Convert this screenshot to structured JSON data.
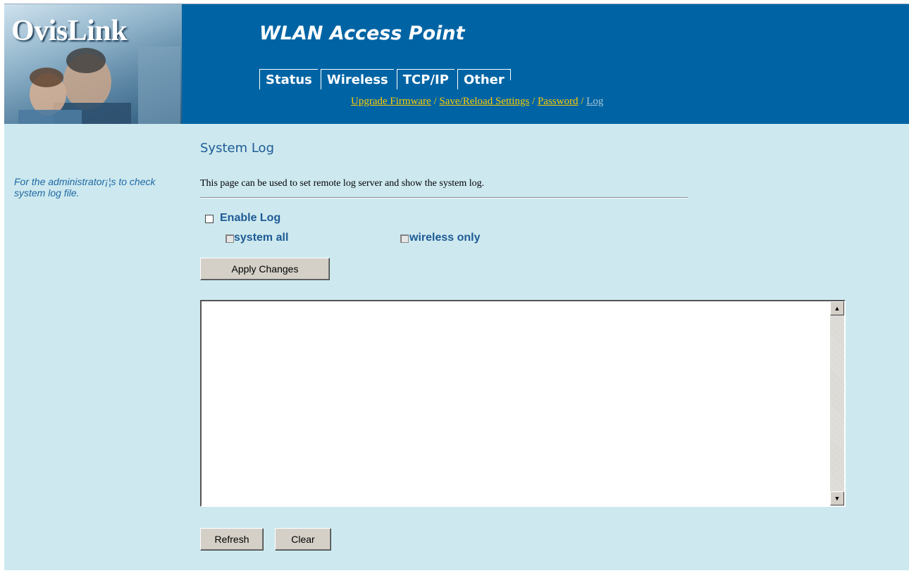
{
  "header": {
    "logo_text": "OvisLink",
    "app_title": "WLAN Access Point",
    "tabs": [
      {
        "label": "Status"
      },
      {
        "label": "Wireless"
      },
      {
        "label": "TCP/IP"
      },
      {
        "label": "Other"
      }
    ],
    "subnav": {
      "items": [
        {
          "label": "Upgrade Firmware"
        },
        {
          "label": "Save/Reload Settings"
        },
        {
          "label": "Password"
        },
        {
          "label": "Log"
        }
      ],
      "separator": "/"
    }
  },
  "sidebar": {
    "note": "For the administrator¡¦s to check system log file."
  },
  "main": {
    "title": "System Log",
    "description": "This page can be used to set remote log server and show the system log.",
    "enable_log": {
      "label": "Enable Log",
      "checked": false
    },
    "system_all": {
      "label": "system all",
      "checked": false,
      "disabled": true
    },
    "wireless_only": {
      "label": "wireless only",
      "checked": false,
      "disabled": true
    },
    "apply_label": "Apply Changes",
    "log_text": "",
    "refresh_label": "Refresh",
    "clear_label": "Clear"
  },
  "colors": {
    "header_bg": "#0064a4",
    "content_bg": "#cde9ef",
    "link_yellow": "#ffcc00",
    "heading_blue": "#1e5a94"
  }
}
